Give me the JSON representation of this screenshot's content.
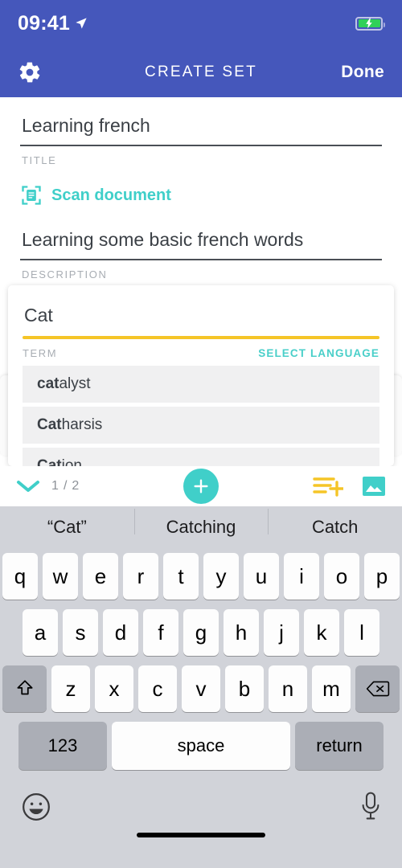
{
  "status_bar": {
    "time": "09:41",
    "location_icon": "location-arrow-icon",
    "battery_icon": "battery-charging-icon"
  },
  "nav_bar": {
    "settings_icon": "gear-icon",
    "title": "CREATE SET",
    "done_label": "Done"
  },
  "form": {
    "title_value": "Learning french",
    "title_label": "TITLE",
    "scan_icon": "scan-document-icon",
    "scan_label": "Scan document",
    "description_value": "Learning some basic french words",
    "description_label": "DESCRIPTION"
  },
  "card": {
    "term_value": "Cat",
    "term_label": "TERM",
    "select_language_label": "SELECT LANGUAGE",
    "suggestions": [
      {
        "bold": "cat",
        "rest": "alyst"
      },
      {
        "bold": "Cat",
        "rest": "harsis"
      },
      {
        "bold": "Cat",
        "rest": "ion"
      }
    ]
  },
  "toolbar": {
    "collapse_icon": "chevron-down-icon",
    "counter": "1 / 2",
    "add_icon": "plus-icon",
    "list_add_icon": "list-add-icon",
    "image_icon": "image-icon"
  },
  "keyboard": {
    "predictions": [
      "“Cat”",
      "Catching",
      "Catch"
    ],
    "row1": [
      "q",
      "w",
      "e",
      "r",
      "t",
      "y",
      "u",
      "i",
      "o",
      "p"
    ],
    "row2": [
      "a",
      "s",
      "d",
      "f",
      "g",
      "h",
      "j",
      "k",
      "l"
    ],
    "row3": [
      "z",
      "x",
      "c",
      "v",
      "b",
      "n",
      "m"
    ],
    "shift_icon": "shift-icon",
    "backspace_icon": "backspace-icon",
    "numbers_label": "123",
    "space_label": "space",
    "return_label": "return",
    "emoji_icon": "emoji-icon",
    "mic_icon": "microphone-icon"
  },
  "colors": {
    "header_blue": "#4557bb",
    "teal": "#40cfc9",
    "yellow": "#f5c527",
    "battery_green": "#30d158"
  }
}
